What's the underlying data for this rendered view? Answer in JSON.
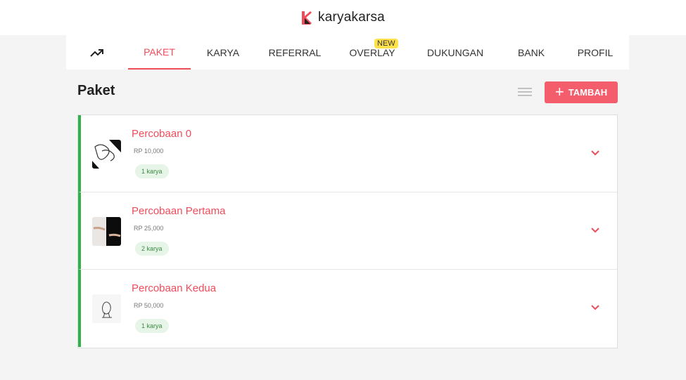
{
  "header": {
    "brand": "karyakarsa"
  },
  "tabs": [
    {
      "label": "PAKET",
      "active": true
    },
    {
      "label": "KARYA"
    },
    {
      "label": "REFERRAL"
    },
    {
      "label": "OVERLAY",
      "badge": "NEW"
    },
    {
      "label": "DUKUNGAN"
    },
    {
      "label": "BANK"
    },
    {
      "label": "PROFIL"
    }
  ],
  "page": {
    "title": "Paket",
    "add_label": "TAMBAH"
  },
  "packages": [
    {
      "name": "Percobaan 0",
      "price": "RP 10,000",
      "count": "1 karya"
    },
    {
      "name": "Percobaan Pertama",
      "price": "RP 25,000",
      "count": "2 karya"
    },
    {
      "name": "Percobaan Kedua",
      "price": "RP 50,000",
      "count": "1 karya"
    }
  ],
  "colors": {
    "accent": "#f04c5a",
    "button": "#f45d6b",
    "active_border": "#2fb24a",
    "badge": "#ffe24b"
  },
  "icons": [
    "trending-up-icon",
    "list-view-icon",
    "plus-icon",
    "chevron-down-icon",
    "karyakarsa-logo-icon"
  ]
}
